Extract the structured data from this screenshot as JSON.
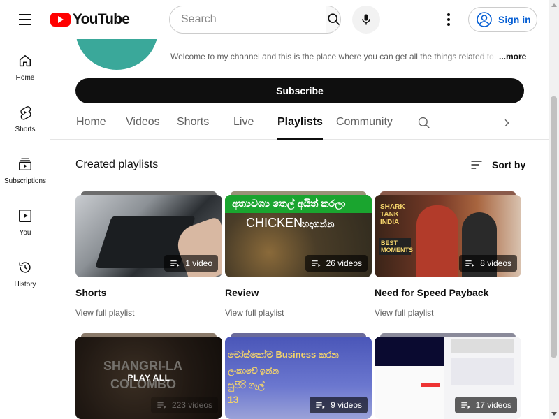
{
  "header": {
    "logo_text": "YouTube",
    "search_placeholder": "Search",
    "sign_in_label": "Sign in",
    "icons": [
      "menu-icon",
      "search-icon",
      "mic-icon",
      "more-vert-icon",
      "account-icon"
    ]
  },
  "sidebar": {
    "items": [
      {
        "label": "Home",
        "icon": "home-icon"
      },
      {
        "label": "Shorts",
        "icon": "shorts-icon"
      },
      {
        "label": "Subscriptions",
        "icon": "subscriptions-icon"
      },
      {
        "label": "You",
        "icon": "you-icon"
      },
      {
        "label": "History",
        "icon": "history-icon"
      }
    ]
  },
  "channel": {
    "description": "Welcome to my channel and this is the place where you can get all the things related to",
    "more_label": "...more",
    "subscribe_label": "Subscribe"
  },
  "tabs": [
    {
      "label": "Home"
    },
    {
      "label": "Videos"
    },
    {
      "label": "Shorts"
    },
    {
      "label": "Live"
    },
    {
      "label": "Playlists",
      "active": true
    },
    {
      "label": "Community"
    }
  ],
  "section": {
    "title": "Created playlists",
    "sort_label": "Sort by"
  },
  "playlists": [
    {
      "title": "Shorts",
      "count": "1 video",
      "link": "View full playlist"
    },
    {
      "title": "Review",
      "count": "26 videos",
      "link": "View full playlist",
      "thumb_text": [
        "අත්‍යවශ්‍ය තෙල් අයිත් කරලා",
        "CHICKEN",
        "හදාගන්න"
      ]
    },
    {
      "title": "Need for Speed Payback",
      "count": "8 videos",
      "link": "View full playlist",
      "thumb_text": [
        "SHARK TANK INDIA",
        "BEST MOMENTS"
      ]
    },
    {
      "title": "",
      "count": "223 videos",
      "overlay": "PLAY ALL",
      "thumb_text": [
        "SHANGRI-LA",
        "COLOMBO"
      ]
    },
    {
      "title": "",
      "count": "9 videos",
      "thumb_text": [
        "මෝස්කෝම Business කරන",
        "ලංකාවේ ඉන්න",
        "සුපිරි ගෑල්",
        "13"
      ]
    },
    {
      "title": "",
      "count": "17 videos"
    }
  ],
  "colors": {
    "brand_red": "#ff0000",
    "link_blue": "#065fd4",
    "channel_avatar": "#3aa89a"
  }
}
